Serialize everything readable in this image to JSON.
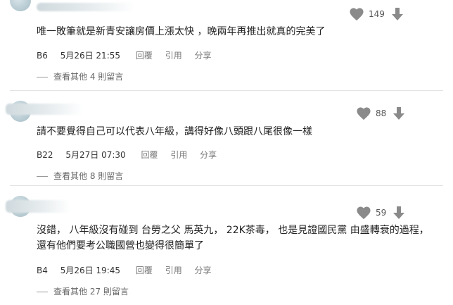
{
  "comments": [
    {
      "text_lines": [
        "唯一敗筆就是新青安讓房價上漲太快 ，晚兩年再推出就真的完美了"
      ],
      "floor": "B6",
      "date": "5月26日 21:55",
      "reply_label": "回覆",
      "quote_label": "引用",
      "share_label": "分享",
      "likes": "149",
      "view_replies": "查看其他 4 則留言"
    },
    {
      "text_lines": [
        "請不要覺得自己可以代表八年級，講得好像八頭跟八尾很像一樣"
      ],
      "floor": "B22",
      "date": "5月27日 07:30",
      "reply_label": "回覆",
      "quote_label": "引用",
      "share_label": "分享",
      "likes": "88",
      "view_replies": "查看其他 8 則留言"
    },
    {
      "text_lines": [
        "沒錯， 八年級沒有碰到 台勞之父 馬英九， 22K茶毒， 也是見證國民黨 由盛轉衰的過程，",
        "還有他們要考公職國營也變得很簡單了"
      ],
      "floor": "B4",
      "date": "5月26日 19:45",
      "reply_label": "回覆",
      "quote_label": "引用",
      "share_label": "分享",
      "likes": "59",
      "view_replies": "查看其他 27 則留言"
    }
  ],
  "icons": {
    "like": "heart-icon",
    "dislike": "arrow-down-icon"
  },
  "colors": {
    "icon_gray": "#8a8a8a",
    "text": "#222222",
    "meta": "#333333"
  }
}
